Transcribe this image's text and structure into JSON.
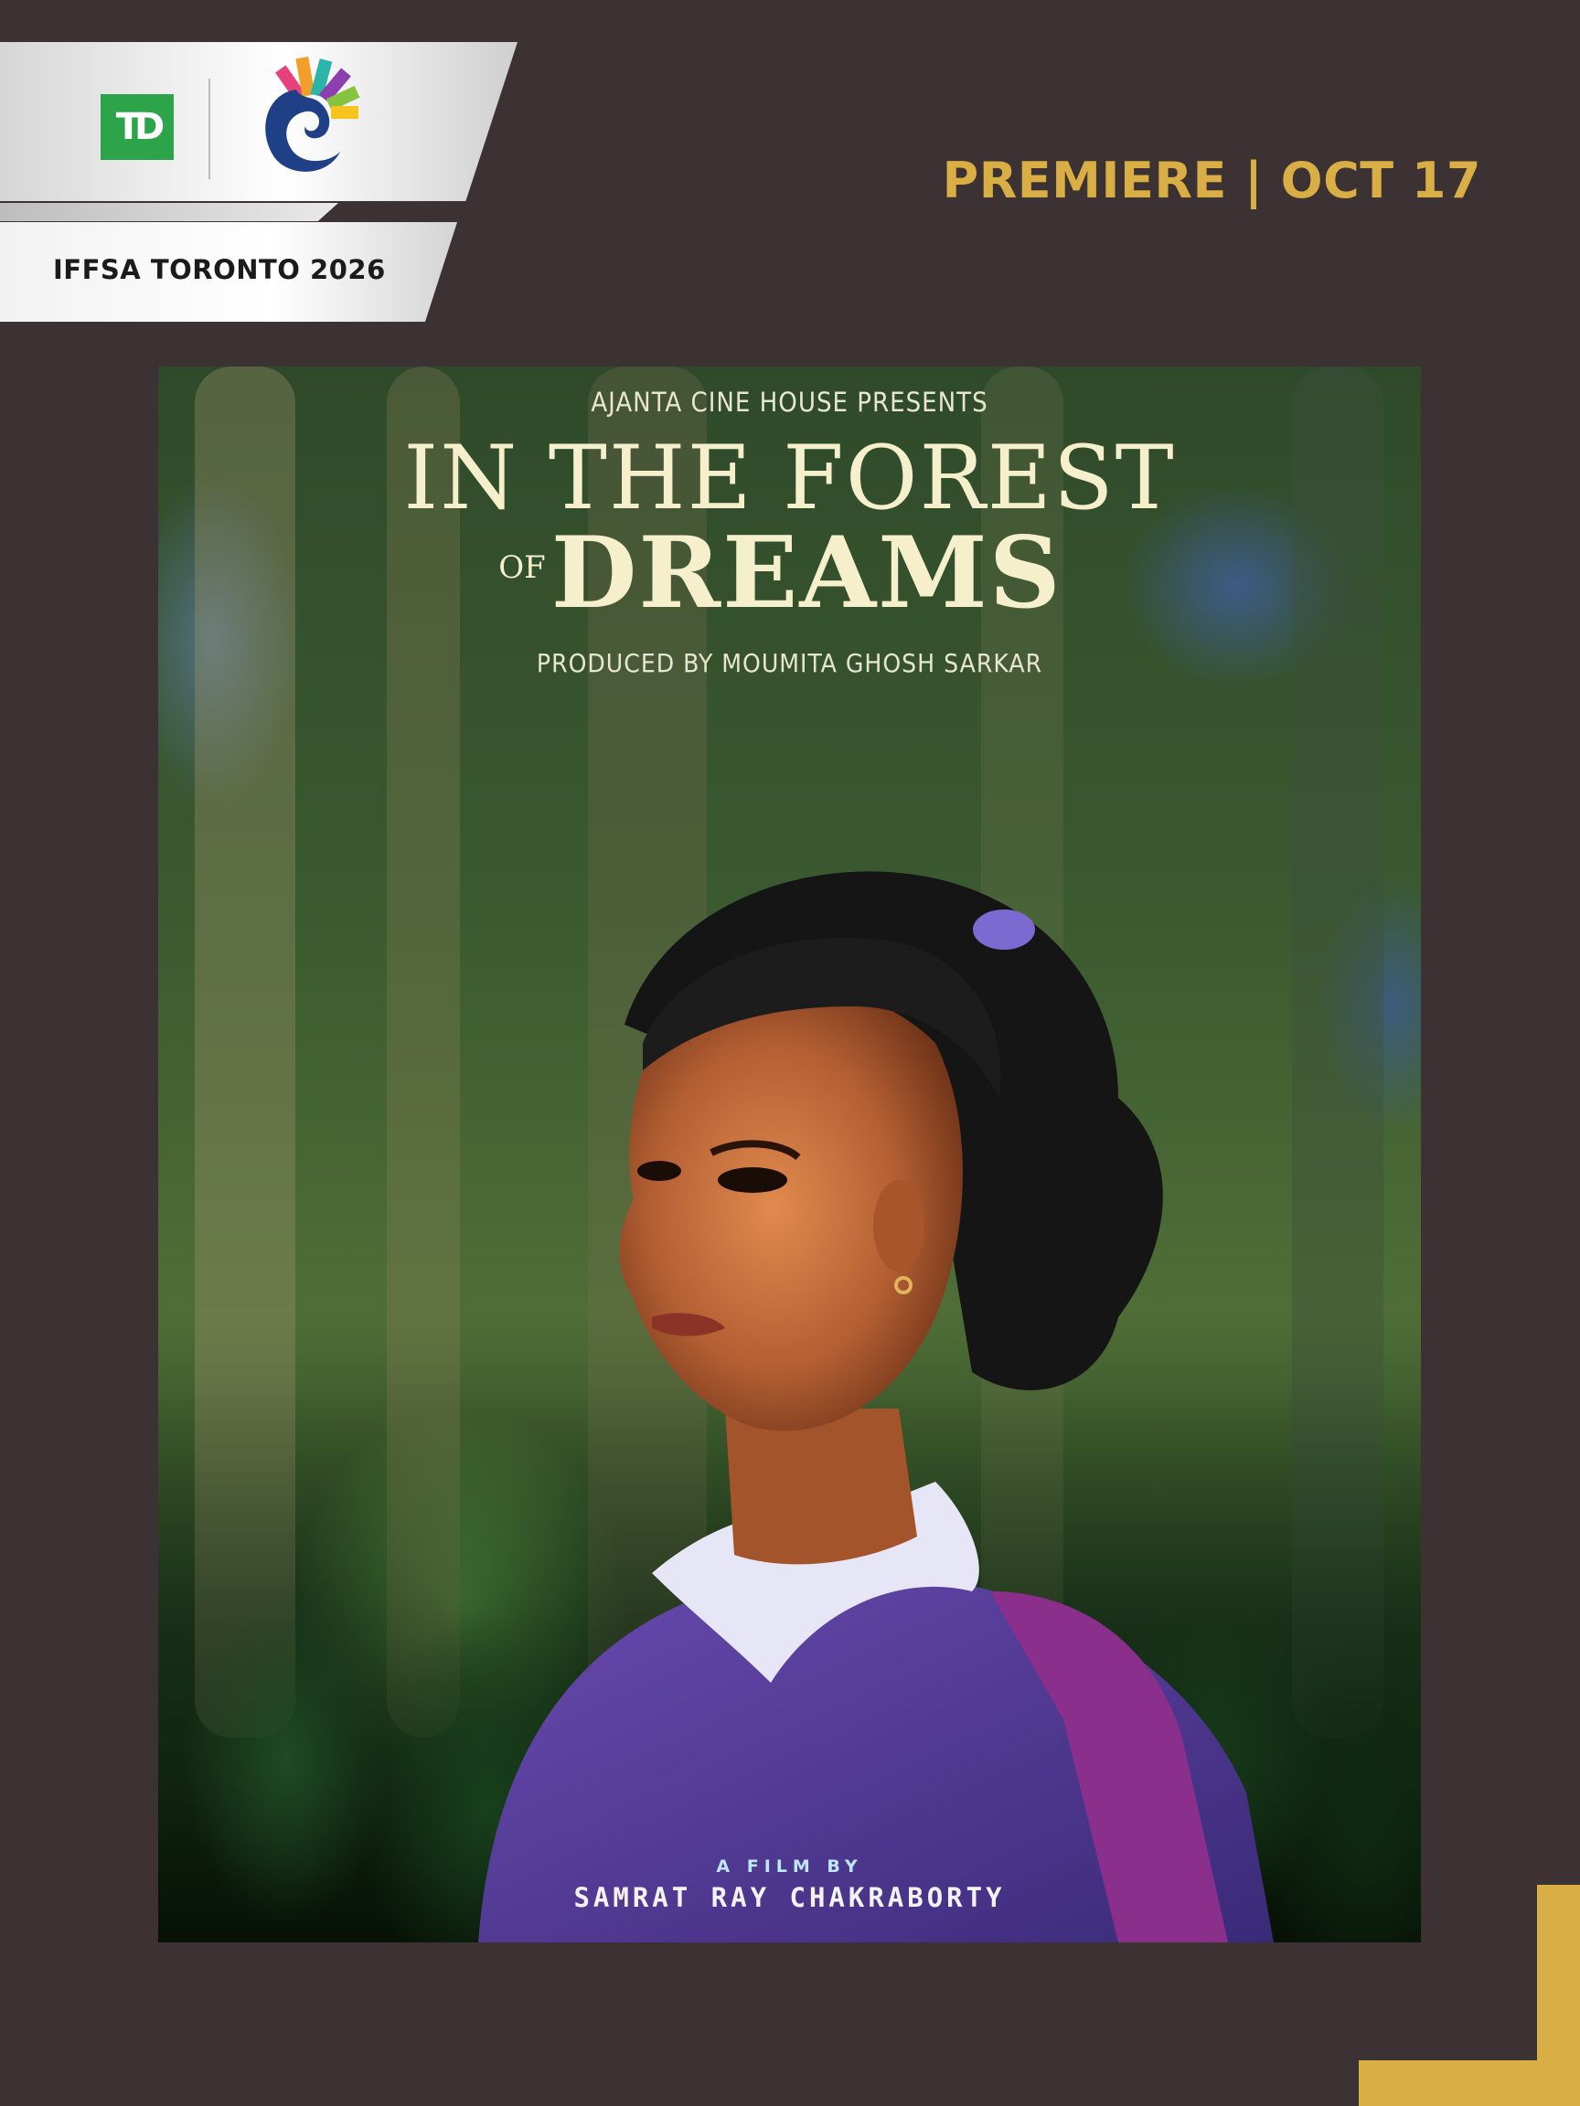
{
  "header": {
    "festival_label": "IFFSA TORONTO 2026",
    "premiere_label": "PREMIERE | OCT 17"
  },
  "sponsor": {
    "logo_text": "TD",
    "logo_color": "#2ea44a"
  },
  "poster": {
    "presents": "AJANTA CINE HOUSE PRESENTS",
    "title_line1": "IN THE FOREST",
    "title_of": "OF",
    "title_dreams": "DREAMS",
    "producer": "PRODUCED BY MOUMITA GHOSH SARKAR",
    "film_by": "A FILM BY",
    "director": "SAMRAT RAY CHAKRABORTY"
  },
  "colors": {
    "background": "#3c3234",
    "accent_gold": "#d9ae45"
  },
  "icons": {
    "festival_emblem": "peacock-film-strip-icon"
  }
}
